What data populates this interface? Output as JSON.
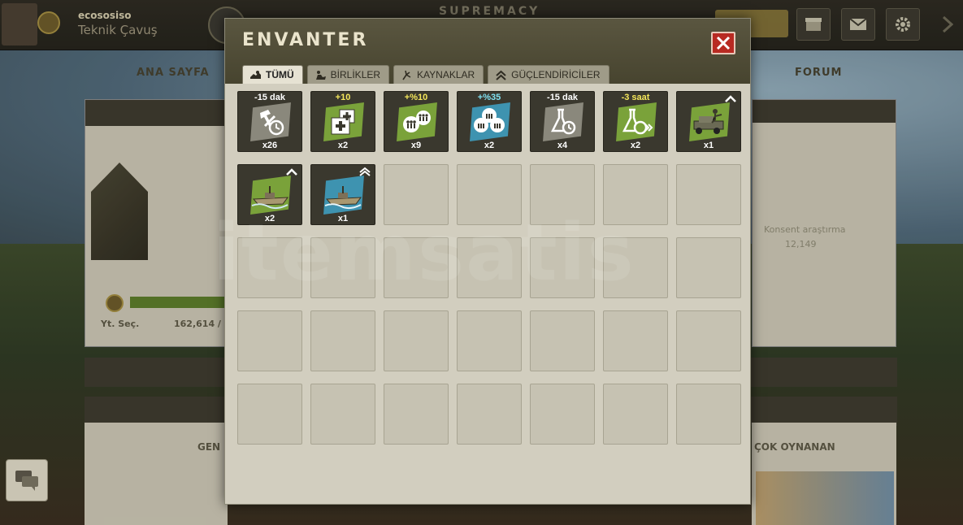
{
  "background": {
    "user_name": "ecososiso",
    "user_rank": "Teknik Çavuş",
    "game_title": "SUPREMACY",
    "nav_left": "ANA SAYFA",
    "nav_right": "FORUM",
    "stat_label": "Yt. Seç.",
    "stat_value": "162,614 /",
    "bottom_left_heading": "GEN",
    "bottom_right_heading": "ÇOK OYNANAN",
    "right_panel_label": "Konsent araştırma",
    "right_panel_value": "12,149",
    "watermark": "itemsatis"
  },
  "modal": {
    "title": "ENVANTER",
    "close_label": "Kapat",
    "tabs": [
      {
        "label": "TÜMÜ",
        "icon": "all-icon",
        "active": true
      },
      {
        "label": "BİRLİKLER",
        "icon": "units-icon",
        "active": false
      },
      {
        "label": "KAYNAKLAR",
        "icon": "resources-icon",
        "active": false
      },
      {
        "label": "GÜÇLENDİRİCİLER",
        "icon": "boosters-icon",
        "active": false
      }
    ],
    "items": [
      {
        "top": "-15 dak",
        "count": "x26",
        "tile": "grey",
        "icon": "construction-speedup-icon",
        "highlight": "white"
      },
      {
        "top": "+10",
        "count": "x2",
        "tile": "green",
        "icon": "medical-supplies-icon",
        "highlight": "yellow"
      },
      {
        "top": "+%10",
        "count": "x9",
        "tile": "green",
        "icon": "manpower-boost-icon",
        "highlight": "yellow"
      },
      {
        "top": "+%35",
        "count": "x2",
        "tile": "blue",
        "icon": "manpower-boost-large-icon",
        "highlight": "cyan"
      },
      {
        "top": "-15 dak",
        "count": "x4",
        "tile": "grey",
        "icon": "research-speedup-icon",
        "highlight": "white"
      },
      {
        "top": "-3 saat",
        "count": "x2",
        "tile": "green",
        "icon": "research-speedup-large-icon",
        "highlight": "yellow"
      },
      {
        "top": "",
        "count": "x1",
        "tile": "green",
        "icon": "armored-car-unit-icon",
        "highlight": "white",
        "tier": true
      },
      {
        "top": "",
        "count": "x2",
        "tile": "green",
        "icon": "gunboat-unit-icon",
        "highlight": "white",
        "tier": true
      },
      {
        "top": "",
        "count": "x1",
        "tile": "blue",
        "icon": "gunboat-unit-elite-icon",
        "highlight": "white",
        "tier": true
      }
    ],
    "total_slots": 35
  },
  "colors": {
    "header_bg": "#4f4b36",
    "modal_bg": "#d2cebf",
    "close_red": "#b82a22",
    "tile_grey": "#8a887c",
    "tile_green": "#7aa23a",
    "tile_blue": "#3e93b0"
  }
}
